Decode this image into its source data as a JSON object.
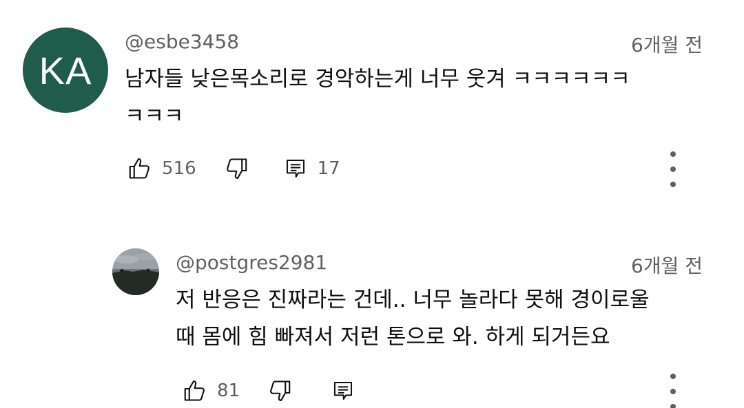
{
  "comments": [
    {
      "avatar_initials": "KA",
      "avatar_color": "#1f5c4a",
      "handle": "@esbe3458",
      "time": "6개월 전",
      "text_lines": [
        "남자들 낮은목소리로 경악하는게 너무 웃겨 ㅋㅋㅋㅋㅋㅋ",
        "ㅋㅋㅋ"
      ],
      "likes": "516",
      "replies": "17"
    },
    {
      "handle": "@postgres2981",
      "time": "6개월 전",
      "text_lines": [
        "저 반응은 진짜라는 건데.. 너무 놀라다 못해 경이로울",
        "때 몸에 힘 빠져서 저런 톤으로 와. 하게 되거든요"
      ],
      "likes": "81"
    }
  ],
  "icons": {
    "like": "thumbs-up-icon",
    "dislike": "thumbs-down-icon",
    "reply": "reply-icon",
    "more": "more-vertical-icon"
  }
}
